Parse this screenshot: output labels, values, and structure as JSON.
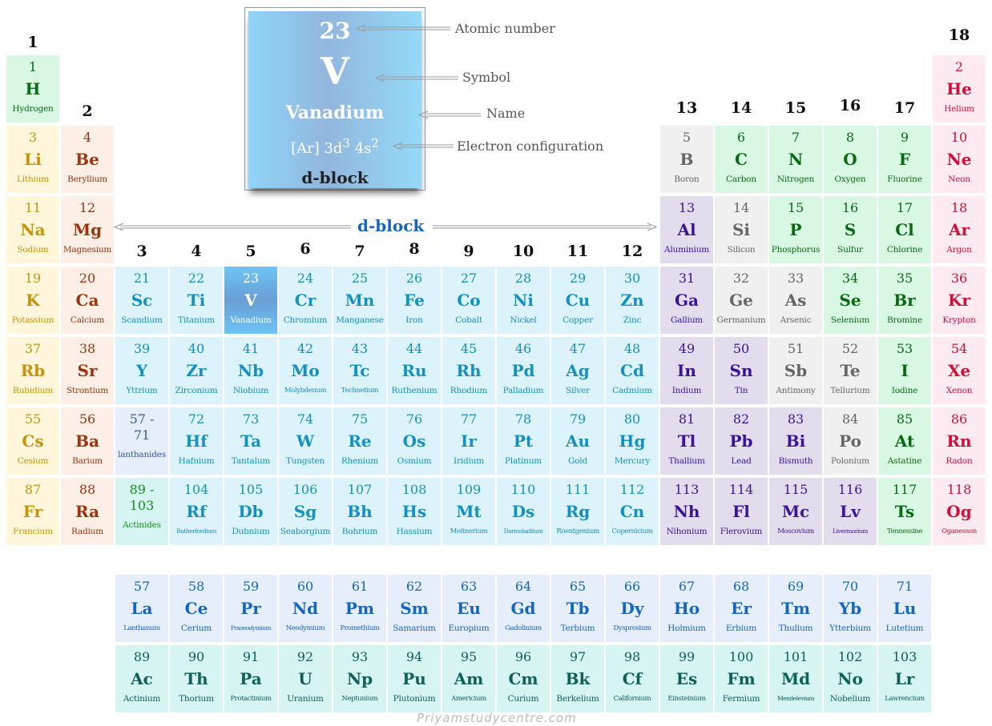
{
  "legend": {
    "atomic_number": "23",
    "symbol": "V",
    "name": "Vanadium",
    "config_base": "[Ar] 3d",
    "config_sup1": "3",
    "config_mid": " 4s",
    "config_sup2": "2",
    "block": "d-block",
    "labels": {
      "atomic_number": "Atomic number",
      "symbol": "Symbol",
      "name": "Name",
      "electron_configuration": "Electron configuration"
    }
  },
  "block_label": "d-block",
  "groups": [
    "1",
    "2",
    "3",
    "4",
    "5",
    "6",
    "7",
    "8",
    "9",
    "10",
    "11",
    "12",
    "13",
    "14",
    "15",
    "16",
    "17",
    "18"
  ],
  "elements": [
    {
      "n": "1",
      "s": "H",
      "name": "Hydrogen",
      "t": "nonmetal",
      "col": 1,
      "row": 1
    },
    {
      "n": "2",
      "s": "He",
      "name": "Helium",
      "t": "noble",
      "col": 18,
      "row": 1
    },
    {
      "n": "3",
      "s": "Li",
      "name": "Lithium",
      "t": "alkali",
      "col": 1,
      "row": 2
    },
    {
      "n": "4",
      "s": "Be",
      "name": "Beryllium",
      "t": "alkaline",
      "col": 2,
      "row": 2
    },
    {
      "n": "5",
      "s": "B",
      "name": "Boron",
      "t": "metalloid",
      "col": 13,
      "row": 2
    },
    {
      "n": "6",
      "s": "C",
      "name": "Carbon",
      "t": "nonmetal",
      "col": 14,
      "row": 2
    },
    {
      "n": "7",
      "s": "N",
      "name": "Nitrogen",
      "t": "nonmetal",
      "col": 15,
      "row": 2
    },
    {
      "n": "8",
      "s": "O",
      "name": "Oxygen",
      "t": "nonmetal",
      "col": 16,
      "row": 2
    },
    {
      "n": "9",
      "s": "F",
      "name": "Fluorine",
      "t": "nonmetal",
      "col": 17,
      "row": 2
    },
    {
      "n": "10",
      "s": "Ne",
      "name": "Neon",
      "t": "noble",
      "col": 18,
      "row": 2
    },
    {
      "n": "11",
      "s": "Na",
      "name": "Sodium",
      "t": "alkali",
      "col": 1,
      "row": 3
    },
    {
      "n": "12",
      "s": "Mg",
      "name": "Magnesium",
      "t": "alkaline",
      "col": 2,
      "row": 3
    },
    {
      "n": "13",
      "s": "Al",
      "name": "Aluminium",
      "t": "post",
      "col": 13,
      "row": 3
    },
    {
      "n": "14",
      "s": "Si",
      "name": "Silicon",
      "t": "metalloid",
      "col": 14,
      "row": 3
    },
    {
      "n": "15",
      "s": "P",
      "name": "Phosphorus",
      "t": "nonmetal",
      "col": 15,
      "row": 3
    },
    {
      "n": "16",
      "s": "S",
      "name": "Sulfur",
      "t": "nonmetal",
      "col": 16,
      "row": 3
    },
    {
      "n": "17",
      "s": "Cl",
      "name": "Chlorine",
      "t": "nonmetal",
      "col": 17,
      "row": 3
    },
    {
      "n": "18",
      "s": "Ar",
      "name": "Argon",
      "t": "noble",
      "col": 18,
      "row": 3
    },
    {
      "n": "19",
      "s": "K",
      "name": "Potassium",
      "t": "alkali",
      "col": 1,
      "row": 4
    },
    {
      "n": "20",
      "s": "Ca",
      "name": "Calcium",
      "t": "alkaline",
      "col": 2,
      "row": 4
    },
    {
      "n": "21",
      "s": "Sc",
      "name": "Scandium",
      "t": "trans",
      "col": 3,
      "row": 4
    },
    {
      "n": "22",
      "s": "Ti",
      "name": "Titanium",
      "t": "trans",
      "col": 4,
      "row": 4
    },
    {
      "n": "23",
      "s": "V",
      "name": "Vanadium",
      "t": "hl",
      "col": 5,
      "row": 4
    },
    {
      "n": "24",
      "s": "Cr",
      "name": "Chromium",
      "t": "trans",
      "col": 6,
      "row": 4
    },
    {
      "n": "25",
      "s": "Mn",
      "name": "Manganese",
      "t": "trans",
      "col": 7,
      "row": 4
    },
    {
      "n": "26",
      "s": "Fe",
      "name": "Iron",
      "t": "trans",
      "col": 8,
      "row": 4
    },
    {
      "n": "27",
      "s": "Co",
      "name": "Cobalt",
      "t": "trans",
      "col": 9,
      "row": 4
    },
    {
      "n": "28",
      "s": "Ni",
      "name": "Nickel",
      "t": "trans",
      "col": 10,
      "row": 4
    },
    {
      "n": "29",
      "s": "Cu",
      "name": "Copper",
      "t": "trans",
      "col": 11,
      "row": 4
    },
    {
      "n": "30",
      "s": "Zn",
      "name": "Zinc",
      "t": "trans",
      "col": 12,
      "row": 4
    },
    {
      "n": "31",
      "s": "Ga",
      "name": "Gallium",
      "t": "post",
      "col": 13,
      "row": 4
    },
    {
      "n": "32",
      "s": "Ge",
      "name": "Germanium",
      "t": "metalloid",
      "col": 14,
      "row": 4
    },
    {
      "n": "33",
      "s": "As",
      "name": "Arsenic",
      "t": "metalloid",
      "col": 15,
      "row": 4
    },
    {
      "n": "34",
      "s": "Se",
      "name": "Selenium",
      "t": "nonmetal",
      "col": 16,
      "row": 4
    },
    {
      "n": "35",
      "s": "Br",
      "name": "Bromine",
      "t": "nonmetal",
      "col": 17,
      "row": 4
    },
    {
      "n": "36",
      "s": "Kr",
      "name": "Krypton",
      "t": "noble",
      "col": 18,
      "row": 4
    },
    {
      "n": "37",
      "s": "Rb",
      "name": "Rubidium",
      "t": "alkali",
      "col": 1,
      "row": 5
    },
    {
      "n": "38",
      "s": "Sr",
      "name": "Strontium",
      "t": "alkaline",
      "col": 2,
      "row": 5
    },
    {
      "n": "39",
      "s": "Y",
      "name": "Yttrium",
      "t": "trans",
      "col": 3,
      "row": 5
    },
    {
      "n": "40",
      "s": "Zr",
      "name": "Zirconium",
      "t": "trans",
      "col": 4,
      "row": 5
    },
    {
      "n": "41",
      "s": "Nb",
      "name": "Niobium",
      "t": "trans",
      "col": 5,
      "row": 5
    },
    {
      "n": "42",
      "s": "Mo",
      "name": "Molybdenum",
      "t": "trans",
      "col": 6,
      "row": 5,
      "sz": "sm"
    },
    {
      "n": "43",
      "s": "Tc",
      "name": "Technetium",
      "t": "trans",
      "col": 7,
      "row": 5,
      "sz": "sm"
    },
    {
      "n": "44",
      "s": "Ru",
      "name": "Ruthenium",
      "t": "trans",
      "col": 8,
      "row": 5
    },
    {
      "n": "45",
      "s": "Rh",
      "name": "Rhodium",
      "t": "trans",
      "col": 9,
      "row": 5
    },
    {
      "n": "46",
      "s": "Pd",
      "name": "Palladium",
      "t": "trans",
      "col": 10,
      "row": 5
    },
    {
      "n": "47",
      "s": "Ag",
      "name": "Silver",
      "t": "trans",
      "col": 11,
      "row": 5
    },
    {
      "n": "48",
      "s": "Cd",
      "name": "Cadmium",
      "t": "trans",
      "col": 12,
      "row": 5
    },
    {
      "n": "49",
      "s": "In",
      "name": "Indium",
      "t": "post",
      "col": 13,
      "row": 5
    },
    {
      "n": "50",
      "s": "Sn",
      "name": "Tin",
      "t": "post",
      "col": 14,
      "row": 5
    },
    {
      "n": "51",
      "s": "Sb",
      "name": "Antimony",
      "t": "metalloid",
      "col": 15,
      "row": 5
    },
    {
      "n": "52",
      "s": "Te",
      "name": "Tellurium",
      "t": "metalloid",
      "col": 16,
      "row": 5
    },
    {
      "n": "53",
      "s": "I",
      "name": "Iodine",
      "t": "nonmetal",
      "col": 17,
      "row": 5
    },
    {
      "n": "54",
      "s": "Xe",
      "name": "Xenon",
      "t": "noble",
      "col": 18,
      "row": 5
    },
    {
      "n": "55",
      "s": "Cs",
      "name": "Cesium",
      "t": "alkali",
      "col": 1,
      "row": 6
    },
    {
      "n": "56",
      "s": "Ba",
      "name": "Barium",
      "t": "alkaline",
      "col": 2,
      "row": 6
    },
    {
      "n": "72",
      "s": "Hf",
      "name": "Hafnium",
      "t": "trans",
      "col": 4,
      "row": 6
    },
    {
      "n": "73",
      "s": "Ta",
      "name": "Tantalum",
      "t": "trans",
      "col": 5,
      "row": 6
    },
    {
      "n": "74",
      "s": "W",
      "name": "Tungsten",
      "t": "trans",
      "col": 6,
      "row": 6
    },
    {
      "n": "75",
      "s": "Re",
      "name": "Rhenium",
      "t": "trans",
      "col": 7,
      "row": 6
    },
    {
      "n": "76",
      "s": "Os",
      "name": "Osmium",
      "t": "trans",
      "col": 8,
      "row": 6
    },
    {
      "n": "77",
      "s": "Ir",
      "name": "Iridium",
      "t": "trans",
      "col": 9,
      "row": 6
    },
    {
      "n": "78",
      "s": "Pt",
      "name": "Platinum",
      "t": "trans",
      "col": 10,
      "row": 6
    },
    {
      "n": "79",
      "s": "Au",
      "name": "Gold",
      "t": "trans",
      "col": 11,
      "row": 6
    },
    {
      "n": "80",
      "s": "Hg",
      "name": "Mercury",
      "t": "trans",
      "col": 12,
      "row": 6
    },
    {
      "n": "81",
      "s": "Tl",
      "name": "Thallium",
      "t": "post",
      "col": 13,
      "row": 6
    },
    {
      "n": "82",
      "s": "Pb",
      "name": "Lead",
      "t": "post",
      "col": 14,
      "row": 6
    },
    {
      "n": "83",
      "s": "Bi",
      "name": "Bismuth",
      "t": "post",
      "col": 15,
      "row": 6
    },
    {
      "n": "84",
      "s": "Po",
      "name": "Polonium",
      "t": "metalloid",
      "col": 16,
      "row": 6
    },
    {
      "n": "85",
      "s": "At",
      "name": "Astatine",
      "t": "nonmetal",
      "col": 17,
      "row": 6
    },
    {
      "n": "86",
      "s": "Rn",
      "name": "Radon",
      "t": "noble",
      "col": 18,
      "row": 6
    },
    {
      "n": "87",
      "s": "Fr",
      "name": "Francium",
      "t": "alkali",
      "col": 1,
      "row": 7
    },
    {
      "n": "88",
      "s": "Ra",
      "name": "Radium",
      "t": "alkaline",
      "col": 2,
      "row": 7
    },
    {
      "n": "104",
      "s": "Rf",
      "name": "Rutherfordium",
      "t": "trans",
      "col": 4,
      "row": 7,
      "sz": "xs"
    },
    {
      "n": "105",
      "s": "Db",
      "name": "Dubnium",
      "t": "trans",
      "col": 5,
      "row": 7
    },
    {
      "n": "106",
      "s": "Sg",
      "name": "Seaborgium",
      "t": "trans",
      "col": 6,
      "row": 7
    },
    {
      "n": "107",
      "s": "Bh",
      "name": "Bohrium",
      "t": "trans",
      "col": 7,
      "row": 7
    },
    {
      "n": "108",
      "s": "Hs",
      "name": "Hassium",
      "t": "trans",
      "col": 8,
      "row": 7
    },
    {
      "n": "109",
      "s": "Mt",
      "name": "Meitnerium",
      "t": "trans",
      "col": 9,
      "row": 7,
      "sz": "sm"
    },
    {
      "n": "110",
      "s": "Ds",
      "name": "Darmstadtium",
      "t": "trans",
      "col": 10,
      "row": 7,
      "sz": "xs"
    },
    {
      "n": "111",
      "s": "Rg",
      "name": "Roentgenium",
      "t": "trans",
      "col": 11,
      "row": 7,
      "sz": "sm"
    },
    {
      "n": "112",
      "s": "Cn",
      "name": "Copernicium",
      "t": "trans",
      "col": 12,
      "row": 7,
      "sz": "sm"
    },
    {
      "n": "113",
      "s": "Nh",
      "name": "Nihonium",
      "t": "post",
      "col": 13,
      "row": 7
    },
    {
      "n": "114",
      "s": "Fl",
      "name": "Flerovium",
      "t": "post",
      "col": 14,
      "row": 7
    },
    {
      "n": "115",
      "s": "Mc",
      "name": "Moscovium",
      "t": "post",
      "col": 15,
      "row": 7,
      "sz": "sm"
    },
    {
      "n": "116",
      "s": "Lv",
      "name": "Livermorium",
      "t": "post",
      "col": 16,
      "row": 7,
      "sz": "xs"
    },
    {
      "n": "117",
      "s": "Ts",
      "name": "Tennessine",
      "t": "nonmetal",
      "col": 17,
      "row": 7,
      "sz": "sm"
    },
    {
      "n": "118",
      "s": "Og",
      "name": "Oganesson",
      "t": "noble",
      "col": 18,
      "row": 7,
      "sz": "sm"
    }
  ],
  "placeholders": [
    {
      "n1": "57 -",
      "n2": "71",
      "name": "lanthanides",
      "t": "lanph",
      "col": 3,
      "row": 6
    },
    {
      "n1": "89 -",
      "n2": "103",
      "name": "Actinides",
      "t": "actph",
      "col": 3,
      "row": 7
    }
  ],
  "f_block": [
    {
      "n": "57",
      "s": "La",
      "name": "Lanthanum",
      "t": "lanth",
      "col": 3,
      "row": 9,
      "sz": "sm"
    },
    {
      "n": "58",
      "s": "Ce",
      "name": "Cerium",
      "t": "lanth",
      "col": 4,
      "row": 9
    },
    {
      "n": "59",
      "s": "Pr",
      "name": "Praseodymium",
      "t": "lanth",
      "col": 5,
      "row": 9,
      "sz": "xs"
    },
    {
      "n": "60",
      "s": "Nd",
      "name": "Neodymium",
      "t": "lanth",
      "col": 6,
      "row": 9,
      "sz": "sm"
    },
    {
      "n": "61",
      "s": "Pm",
      "name": "Promethium",
      "t": "lanth",
      "col": 7,
      "row": 9,
      "sz": "sm"
    },
    {
      "n": "62",
      "s": "Sm",
      "name": "Samarium",
      "t": "lanth",
      "col": 8,
      "row": 9
    },
    {
      "n": "63",
      "s": "Eu",
      "name": "Europium",
      "t": "lanth",
      "col": 9,
      "row": 9
    },
    {
      "n": "64",
      "s": "Gd",
      "name": "Gadolinium",
      "t": "lanth",
      "col": 10,
      "row": 9,
      "sz": "sm"
    },
    {
      "n": "65",
      "s": "Tb",
      "name": "Terbium",
      "t": "lanth",
      "col": 11,
      "row": 9
    },
    {
      "n": "66",
      "s": "Dy",
      "name": "Dysprosium",
      "t": "lanth",
      "col": 12,
      "row": 9,
      "sz": "sm"
    },
    {
      "n": "67",
      "s": "Ho",
      "name": "Holmium",
      "t": "lanth",
      "col": 13,
      "row": 9
    },
    {
      "n": "68",
      "s": "Er",
      "name": "Erbium",
      "t": "lanth",
      "col": 14,
      "row": 9
    },
    {
      "n": "69",
      "s": "Tm",
      "name": "Thulium",
      "t": "lanth",
      "col": 15,
      "row": 9
    },
    {
      "n": "70",
      "s": "Yb",
      "name": "Ytterbium",
      "t": "lanth",
      "col": 16,
      "row": 9
    },
    {
      "n": "71",
      "s": "Lu",
      "name": "Lutetium",
      "t": "lanth",
      "col": 17,
      "row": 9
    },
    {
      "n": "89",
      "s": "Ac",
      "name": "Actinium",
      "t": "act",
      "col": 3,
      "row": 10
    },
    {
      "n": "90",
      "s": "Th",
      "name": "Thorium",
      "t": "act",
      "col": 4,
      "row": 10
    },
    {
      "n": "91",
      "s": "Pa",
      "name": "Protactinium",
      "t": "act",
      "col": 5,
      "row": 10,
      "sz": "sm"
    },
    {
      "n": "92",
      "s": "U",
      "name": "Uranium",
      "t": "act",
      "col": 6,
      "row": 10
    },
    {
      "n": "93",
      "s": "Np",
      "name": "Neptunium",
      "t": "act",
      "col": 7,
      "row": 10,
      "sz": "sm"
    },
    {
      "n": "94",
      "s": "Pu",
      "name": "Plutonium",
      "t": "act",
      "col": 8,
      "row": 10
    },
    {
      "n": "95",
      "s": "Am",
      "name": "Americium",
      "t": "act",
      "col": 9,
      "row": 10,
      "sz": "sm"
    },
    {
      "n": "96",
      "s": "Cm",
      "name": "Curium",
      "t": "act",
      "col": 10,
      "row": 10
    },
    {
      "n": "97",
      "s": "Bk",
      "name": "Berkelium",
      "t": "act",
      "col": 11,
      "row": 10
    },
    {
      "n": "98",
      "s": "Cf",
      "name": "Californium",
      "t": "act",
      "col": 12,
      "row": 10,
      "sz": "sm"
    },
    {
      "n": "99",
      "s": "Es",
      "name": "Einsteinium",
      "t": "act",
      "col": 13,
      "row": 10,
      "sz": "sm"
    },
    {
      "n": "100",
      "s": "Fm",
      "name": "Fermium",
      "t": "act",
      "col": 14,
      "row": 10
    },
    {
      "n": "101",
      "s": "Md",
      "name": "Mendelevium",
      "t": "act",
      "col": 15,
      "row": 10,
      "sz": "xs"
    },
    {
      "n": "102",
      "s": "No",
      "name": "Nobelium",
      "t": "act",
      "col": 16,
      "row": 10
    },
    {
      "n": "103",
      "s": "Lr",
      "name": "Lawrencium",
      "t": "act",
      "col": 17,
      "row": 10,
      "sz": "sm"
    }
  ],
  "watermark": "Priyamstudycentre.com"
}
